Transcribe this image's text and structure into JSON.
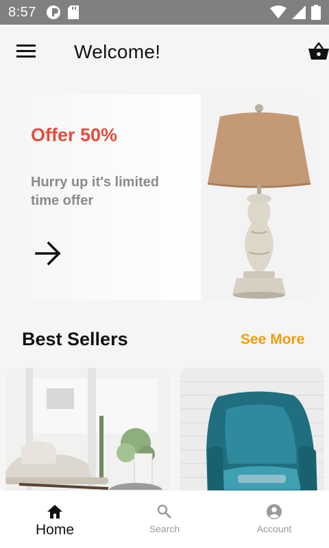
{
  "status_bar": {
    "time": "8:57",
    "left_icons": [
      "sync-icon",
      "sd-card-icon"
    ],
    "right_icons": [
      "wifi-icon",
      "signal-icon",
      "battery-icon"
    ]
  },
  "app_bar": {
    "title": "Welcome!",
    "menu_icon": "menu-icon",
    "cart_icon": "basket-icon"
  },
  "offer": {
    "title": "Offer 50%",
    "subtitle": "Hurry up it's limited time offer",
    "arrow_icon": "arrow-right-icon",
    "image": "table-lamp-image",
    "title_color": "#e84a3c"
  },
  "best_sellers": {
    "title": "Best Sellers",
    "see_more": "See More",
    "see_more_color": "#f59c0b",
    "products": [
      {
        "image": "white-lounge-chair-image"
      },
      {
        "image": "teal-armchair-image"
      }
    ]
  },
  "bottom_nav": {
    "items": [
      {
        "label": "Home",
        "icon": "home-icon",
        "active": true
      },
      {
        "label": "Search",
        "icon": "search-icon",
        "active": false
      },
      {
        "label": "Account",
        "icon": "account-icon",
        "active": false
      }
    ]
  }
}
